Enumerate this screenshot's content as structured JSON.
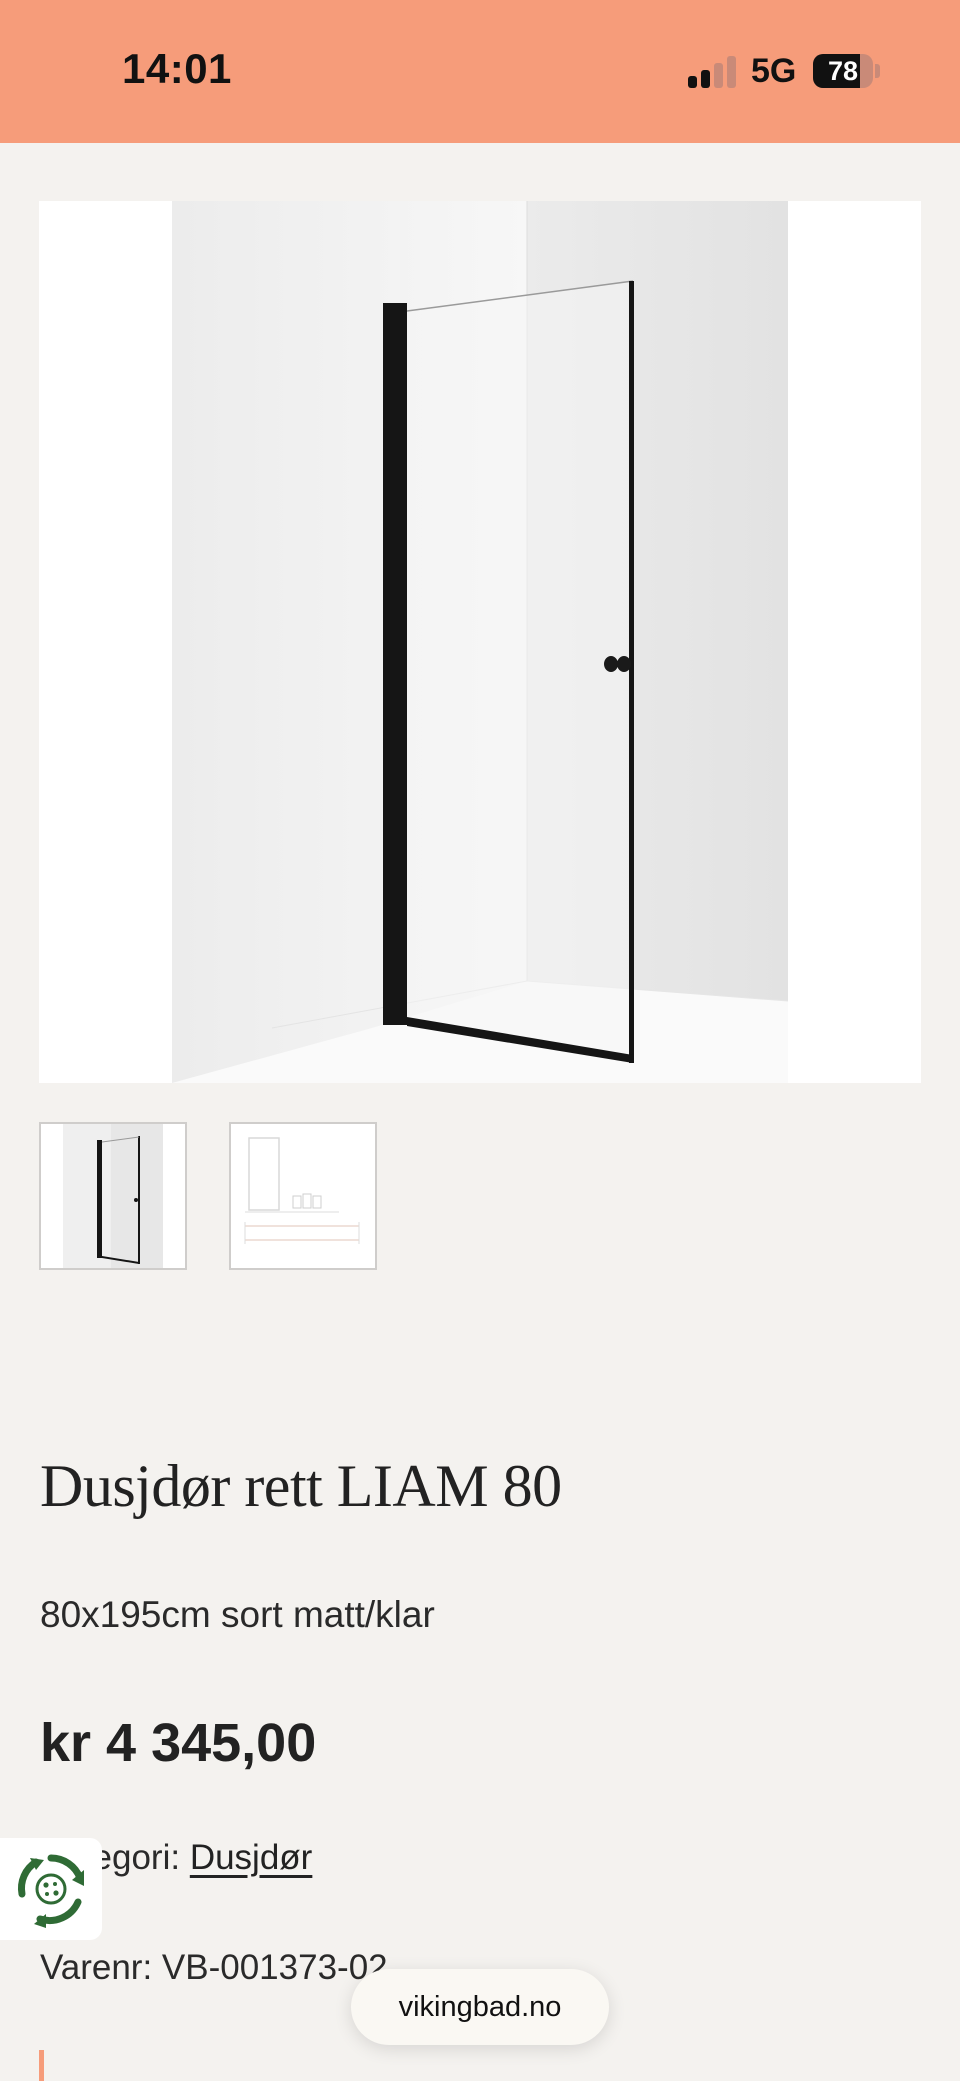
{
  "status_bar": {
    "time": "14:01",
    "network": "5G",
    "battery": "78",
    "battery_level": 0.78,
    "signal_bars_active": 2,
    "signal_bars_total": 4,
    "color": "#f69c7a"
  },
  "gallery": {
    "main_image_icon": "shower-door-photo",
    "thumbnails": [
      {
        "icon": "shower-door-thumbnail"
      },
      {
        "icon": "technical-drawing-thumbnail"
      }
    ]
  },
  "product": {
    "title": "Dusjdør rett LIAM 80",
    "subtitle": "80x195cm sort matt/klar",
    "price": "kr 4 345,00",
    "category_label": "Kategori: ",
    "category_link": "Dusjdør",
    "sku": "Varenr: VB-001373-02"
  },
  "cookie_badge": {
    "icon": "cookie-consent-icon"
  },
  "browser": {
    "url": "vikingbad.no"
  },
  "colors": {
    "accent": "#f69c7a",
    "page_background": "#f4f2ef",
    "text": "#222222",
    "cookie_green": "#2f6b35"
  }
}
